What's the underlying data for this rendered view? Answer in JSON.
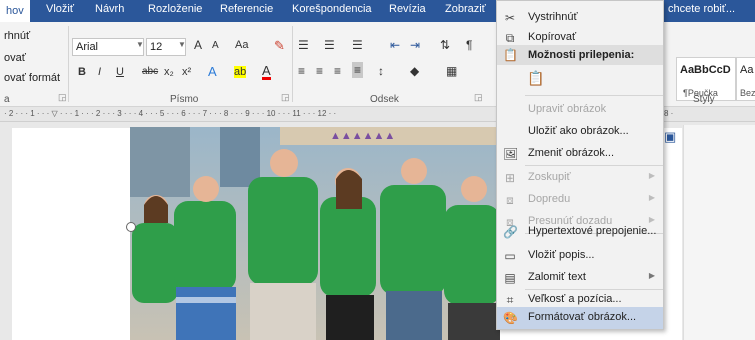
{
  "tabs": [
    "hov",
    "Vložiť",
    "Návrh",
    "Rozloženie",
    "Referencie",
    "Korešpondencia",
    "Revízia",
    "Zobraziť"
  ],
  "tell_me": "chcete robiť...",
  "clipboard": {
    "items": [
      "rhnúť",
      "ovať",
      "ovať formát"
    ],
    "group": "a"
  },
  "font": {
    "name": "Arial",
    "size": "12",
    "grow": "A",
    "shrink": "A",
    "case": "Aa",
    "bold": "B",
    "italic": "I",
    "underline": "U",
    "strike": "abc",
    "sub": "x₂",
    "sup": "x²",
    "text_effects": "A",
    "highlight": "ab",
    "color": "A",
    "group": "Písmo"
  },
  "paragraph": {
    "group": "Odsek"
  },
  "styles": {
    "sample1": "AaBbCcD",
    "sample1_name": "¶Poučka",
    "sample2": "Aa",
    "sample2_name": "Bez",
    "group": "Štýly"
  },
  "ruler": {
    "text": "· 2 · · · 1 · · · ▽ · · · 1 · · · 2 · · · 3 · · · 4 · · · 5 · · · 6 · · · 7 · · · 8 · · · 9 · · · 10 · · · 11 · · · 12 · ·",
    "end": "8 ·"
  },
  "context_menu": {
    "cut": "Vystrihnúť",
    "copy": "Kopírovať",
    "paste_options": "Možnosti prilepenia:",
    "edit_image": "Upraviť obrázok",
    "save_as_image": "Uložiť ako obrázok...",
    "change_image": "Zmeniť obrázok...",
    "group": "Zoskupiť",
    "bring_forward": "Dopredu",
    "send_backward": "Presunúť dozadu",
    "hyperlink": "Hypertextové prepojenie...",
    "insert_caption": "Vložiť popis...",
    "wrap_text": "Zalomiť text",
    "size_position": "Veľkosť a pozícia...",
    "format_image": "Formátovať obrázok..."
  },
  "colors": {
    "accent": "#2b579a",
    "hover": "#c5d3e8"
  }
}
